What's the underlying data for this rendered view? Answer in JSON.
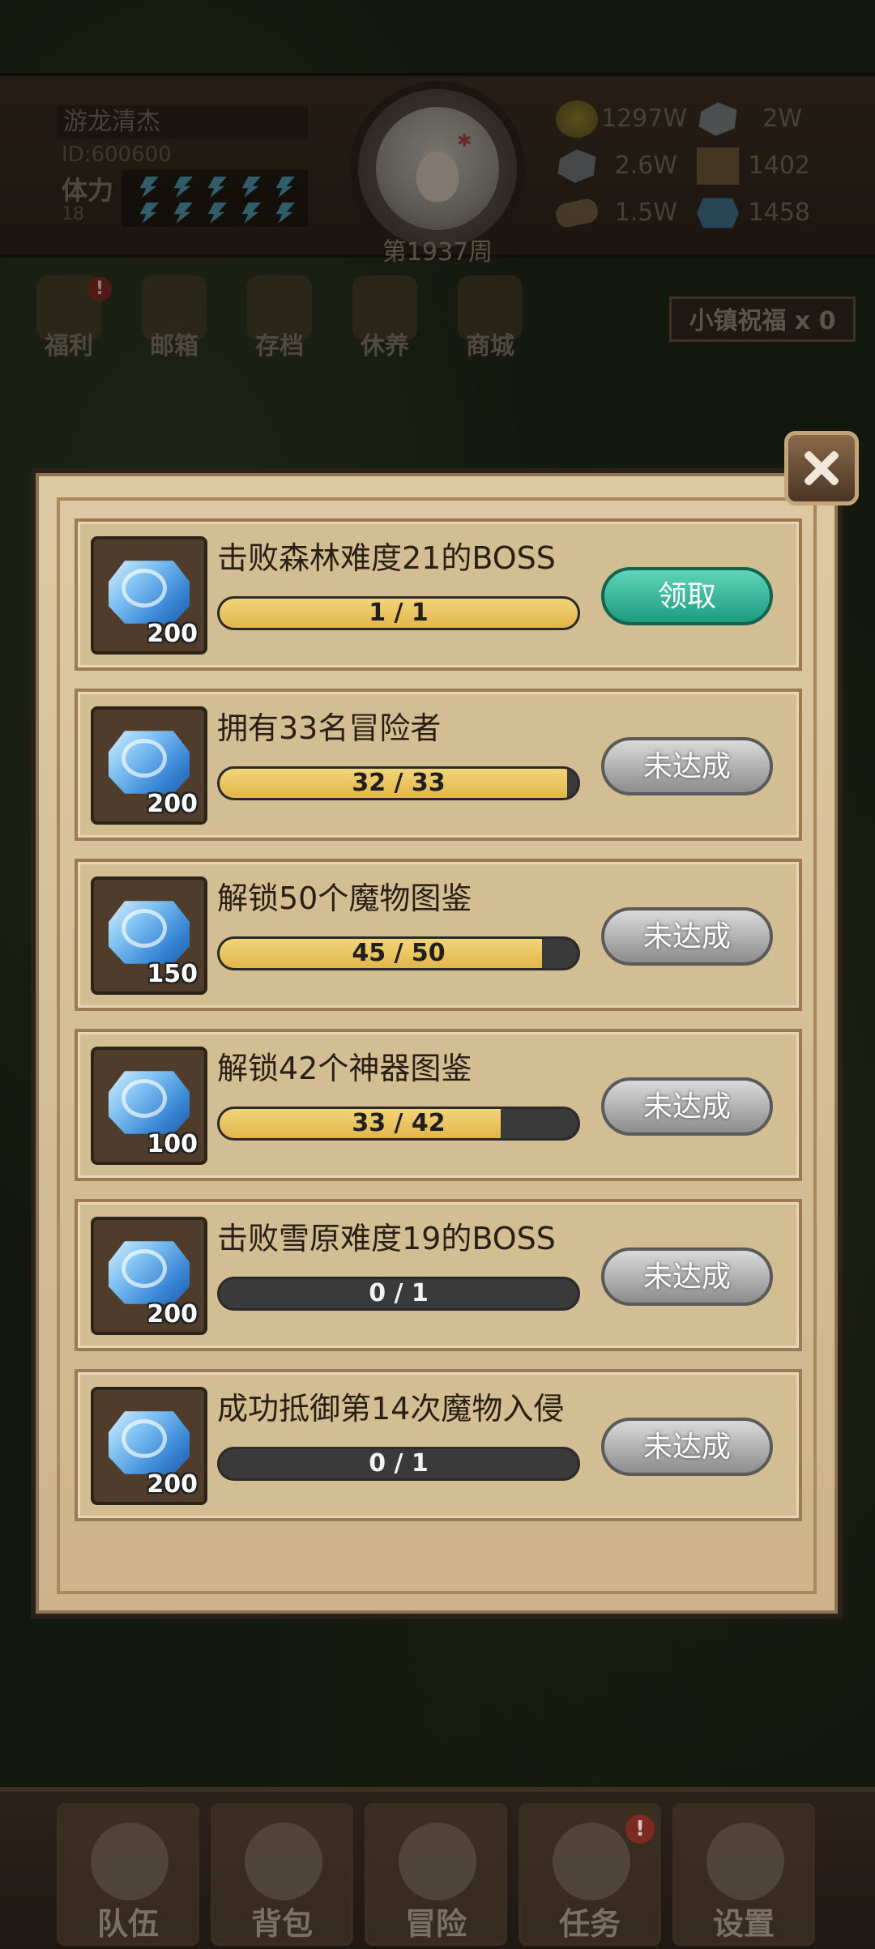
{
  "player": {
    "name": "游龙清杰",
    "id_text": "ID:600600",
    "stamina_label": "体力",
    "stamina_value": "18",
    "week_text": "第1937周"
  },
  "resources": [
    {
      "icon": "gold-coin-icon",
      "value": "1297W"
    },
    {
      "icon": "iron-ingot-icon",
      "value": "2W"
    },
    {
      "icon": "stone-icon",
      "value": "2.6W"
    },
    {
      "icon": "parchment-icon",
      "value": "1402"
    },
    {
      "icon": "wood-log-icon",
      "value": "1.5W"
    },
    {
      "icon": "crystal-icon",
      "value": "1458"
    }
  ],
  "shortcuts": [
    {
      "label": "福利",
      "badge": "!"
    },
    {
      "label": "邮箱"
    },
    {
      "label": "存档"
    },
    {
      "label": "休养"
    },
    {
      "label": "商城"
    }
  ],
  "blessing": "小镇祝福 x 0",
  "quests": [
    {
      "title": "击败森林难度21的BOSS",
      "reward": "200",
      "progress_text": "1 / 1",
      "progress": 1.0,
      "button": "领取",
      "status": "claim"
    },
    {
      "title": "拥有33名冒险者",
      "reward": "200",
      "progress_text": "32 / 33",
      "progress": 0.97,
      "button": "未达成",
      "status": "locked"
    },
    {
      "title": "解锁50个魔物图鉴",
      "reward": "150",
      "progress_text": "45 / 50",
      "progress": 0.9,
      "button": "未达成",
      "status": "locked"
    },
    {
      "title": "解锁42个神器图鉴",
      "reward": "100",
      "progress_text": "33 / 42",
      "progress": 0.786,
      "button": "未达成",
      "status": "locked"
    },
    {
      "title": "击败雪原难度19的BOSS",
      "reward": "200",
      "progress_text": "0 / 1",
      "progress": 0.0,
      "button": "未达成",
      "status": "locked"
    },
    {
      "title": "成功抵御第14次魔物入侵",
      "reward": "200",
      "progress_text": "0 / 1",
      "progress": 0.0,
      "button": "未达成",
      "status": "locked"
    }
  ],
  "bottom_nav": [
    {
      "label": "队伍"
    },
    {
      "label": "背包"
    },
    {
      "label": "冒险"
    },
    {
      "label": "任务",
      "badge": "!"
    },
    {
      "label": "设置"
    }
  ]
}
